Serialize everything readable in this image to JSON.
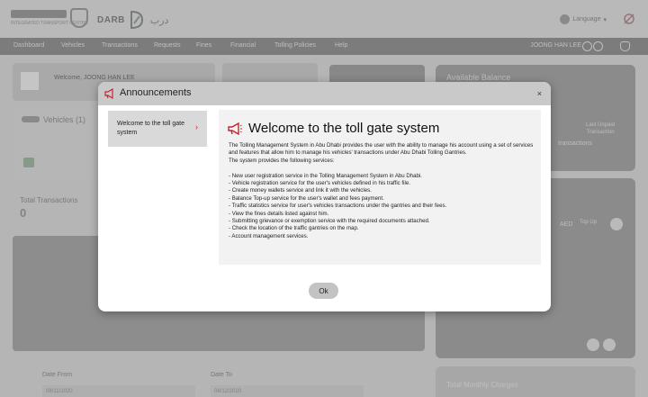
{
  "header": {
    "logo_text": "INTEGRATED TRANSPORT CENTRE",
    "brand": "DARB",
    "brand_ar": "درب",
    "language_label": "Language"
  },
  "nav": {
    "items": [
      "Dashboard",
      "Vehicles",
      "Transactions",
      "Requests",
      "Fines",
      "Financial",
      "Tolling Policies",
      "Help"
    ],
    "user_name": "JOONG HAN LEE"
  },
  "background": {
    "welcome_text": "Welcome, JOONG HAN LEE",
    "vehicles_label": "Vehicles (1)",
    "total_transactions_label": "Total Transactions",
    "total_transactions_value": "0",
    "available_balance_label": "Available Balance",
    "last_unpaid_label": "Last Unpaid Transaction",
    "transactions_label": "transactions",
    "aed_label": "AED",
    "top_up_label": "Top Up",
    "total_monthly_charges_label": "Total Monthly Charges",
    "date_from_label": "Date From",
    "date_from_value": "08/11/2020",
    "date_to_label": "Date To",
    "date_to_value": "08/12/2020"
  },
  "modal": {
    "title": "Announcements",
    "close_label": "×",
    "sidebar_items": [
      {
        "label": "Welcome to the toll gate system"
      }
    ],
    "content": {
      "heading": "Welcome to the toll gate system",
      "body": "The Tolling Management System in Abu Dhabi provides the user with the ability to manage his account using a set of services and features that allow him to manage his vehicles' transactions under Abu Dhabi Tolling Gantries.\n The system provides the following services:\n\n- New user registration service in the Tolling Management System in Abu Dhabi.\n- Vehicle registration service for the user's vehicles defined in his traffic file.\n- Create money wallets service and link it with the vehicles.\n- Balance Top-up service for the user's wallet and fees payment.\n- Traffic statistics service for user's vehicles transactions under the gantries and their fees.\n- View the fines details listed against him.\n- Submitting grievance or exemption service with the required documents attached.\n- Check the location of the traffic gantries on the map.\n- Account management services."
    },
    "ok_label": "Ok"
  },
  "colors": {
    "accent_red": "#c4262e",
    "modal_header": "#c9c9c9",
    "content_bg": "#f2f2f2"
  },
  "icons": [
    "megaphone-icon",
    "close-icon",
    "chevron-right-icon",
    "globe-icon",
    "user-icon",
    "power-icon",
    "bell-icon",
    "refresh-icon"
  ]
}
